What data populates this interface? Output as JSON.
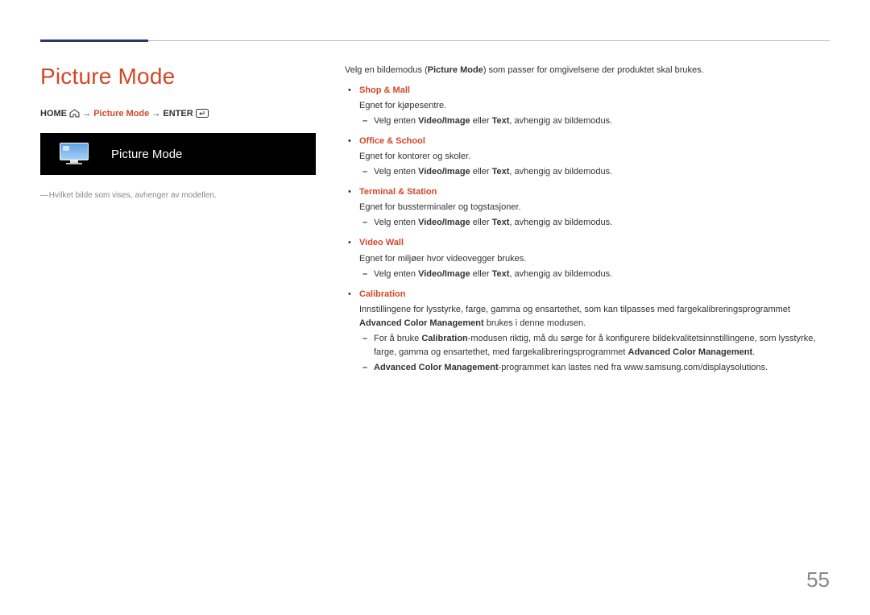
{
  "title": "Picture Mode",
  "breadcrumb": {
    "home": "HOME",
    "arrow1": "→",
    "pm": "Picture Mode",
    "arrow2": "→",
    "enter": "ENTER"
  },
  "screenshot_label": "Picture Mode",
  "footnote": "Hvilket bilde som vises, avhenger av modellen.",
  "intro_pre": "Velg en bildemodus (",
  "intro_pm": "Picture Mode",
  "intro_post": ") som passer for omgivelsene der produktet skal brukes.",
  "sub_common_pre": "Velg enten ",
  "sub_common_vi": "Video/Image",
  "sub_common_mid": " eller ",
  "sub_common_text": "Text",
  "sub_common_post": ", avhengig av bildemodus.",
  "modes": [
    {
      "name": "Shop & Mall",
      "desc": "Egnet for kjøpesentre."
    },
    {
      "name": "Office & School",
      "desc": "Egnet for kontorer og skoler."
    },
    {
      "name": "Terminal & Station",
      "desc": "Egnet for bussterminaler og togstasjoner."
    },
    {
      "name": "Video Wall",
      "desc": "Egnet for miljøer hvor videovegger brukes."
    }
  ],
  "calibration": {
    "name": "Calibration",
    "desc_pre": "Innstillingene for lysstyrke, farge, gamma og ensartethet, som kan tilpasses med fargekalibreringsprogrammet ",
    "desc_acm": "Advanced Color Management",
    "desc_post": " brukes i denne modusen.",
    "sub1_pre": "For å bruke ",
    "sub1_cal": "Calibration",
    "sub1_mid": "-modusen riktig, må du sørge for å konfigurere bildekvalitetsinnstillingene, som lysstyrke, farge, gamma og ensartethet, med fargekalibreringsprogrammet ",
    "sub1_acm": "Advanced Color Management",
    "sub1_post": ".",
    "sub2_acm": "Advanced Color Management",
    "sub2_post": "-programmet kan lastes ned fra www.samsung.com/displaysolutions."
  },
  "page_number": "55"
}
